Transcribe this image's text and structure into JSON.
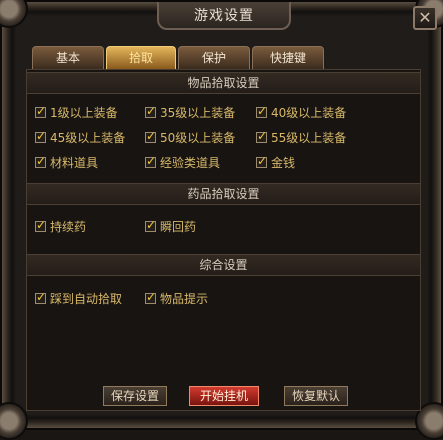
{
  "window": {
    "title": "游戏设置",
    "close_symbol": "✕"
  },
  "tabs": [
    {
      "label": "基本",
      "active": false
    },
    {
      "label": "拾取",
      "active": true
    },
    {
      "label": "保护",
      "active": false
    },
    {
      "label": "快捷键",
      "active": false
    }
  ],
  "sections": {
    "item_pickup": {
      "title": "物品拾取设置",
      "options": [
        {
          "label": "1级以上装备",
          "checked": true
        },
        {
          "label": "35级以上装备",
          "checked": true
        },
        {
          "label": "40级以上装备",
          "checked": true
        },
        {
          "label": "45级以上装备",
          "checked": true
        },
        {
          "label": "50级以上装备",
          "checked": true
        },
        {
          "label": "55级以上装备",
          "checked": true
        },
        {
          "label": "材料道具",
          "checked": true
        },
        {
          "label": "经验类道具",
          "checked": true
        },
        {
          "label": "金钱",
          "checked": true
        }
      ]
    },
    "potion_pickup": {
      "title": "药品拾取设置",
      "options": [
        {
          "label": "持续药",
          "checked": true
        },
        {
          "label": "瞬回药",
          "checked": true
        }
      ]
    },
    "general": {
      "title": "综合设置",
      "options": [
        {
          "label": "踩到自动拾取",
          "checked": true
        },
        {
          "label": "物品提示",
          "checked": true
        }
      ]
    }
  },
  "buttons": {
    "save": "保存设置",
    "start": "开始挂机",
    "restore": "恢复默认"
  },
  "colors": {
    "accent": "#f4c73c",
    "label": "#d8b86a",
    "primary_button": "#d23a2f"
  }
}
